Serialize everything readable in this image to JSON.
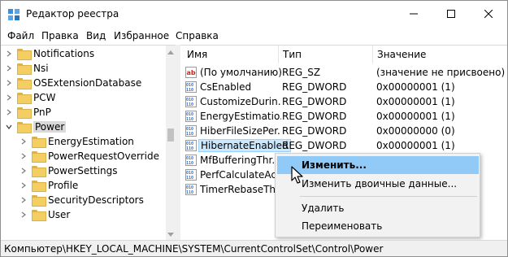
{
  "window": {
    "title": "Редактор реестра",
    "controls": [
      "minimize-icon",
      "maximize-icon",
      "close-icon"
    ]
  },
  "menu": [
    "Файл",
    "Правка",
    "Вид",
    "Избранное",
    "Справка"
  ],
  "tree": {
    "items": [
      {
        "label": "Notifications",
        "level": 1,
        "expander": "chevron-right-icon"
      },
      {
        "label": "Nsi",
        "level": 1,
        "expander": "chevron-right-icon"
      },
      {
        "label": "OSExtensionDatabase",
        "level": 1,
        "expander": "chevron-right-icon"
      },
      {
        "label": "PCW",
        "level": 1,
        "expander": "chevron-right-icon"
      },
      {
        "label": "PnP",
        "level": 1,
        "expander": "chevron-right-icon"
      },
      {
        "label": "Power",
        "level": 1,
        "expander": "chevron-down-icon",
        "selected": true
      },
      {
        "label": "EnergyEstimation",
        "level": 2,
        "expander": "chevron-right-icon"
      },
      {
        "label": "PowerRequestOverride",
        "level": 2,
        "expander": "chevron-right-icon"
      },
      {
        "label": "PowerSettings",
        "level": 2,
        "expander": "chevron-right-icon"
      },
      {
        "label": "Profile",
        "level": 2,
        "expander": "chevron-right-icon"
      },
      {
        "label": "SecurityDescriptors",
        "level": 2,
        "expander": "chevron-right-icon"
      },
      {
        "label": "User",
        "level": 2,
        "expander": "chevron-right-icon"
      }
    ]
  },
  "list": {
    "columns": [
      "Имя",
      "Тип",
      "Значение"
    ],
    "rows": [
      {
        "icon": "string-value-icon",
        "name": "(По умолчанию)",
        "type": "REG_SZ",
        "value": "(значение не присвоено)"
      },
      {
        "icon": "binary-value-icon",
        "name": "CsEnabled",
        "type": "REG_DWORD",
        "value": "0x00000001 (1)"
      },
      {
        "icon": "binary-value-icon",
        "name": "CustomizeDurin...",
        "type": "REG_DWORD",
        "value": "0x00000001 (1)"
      },
      {
        "icon": "binary-value-icon",
        "name": "EnergyEstimatio...",
        "type": "REG_DWORD",
        "value": "0x00000001 (1)"
      },
      {
        "icon": "binary-value-icon",
        "name": "HiberFileSizePer...",
        "type": "REG_DWORD",
        "value": "0x00000000 (0)"
      },
      {
        "icon": "binary-value-icon",
        "name": "HibernateEnabled",
        "type": "REG_DWORD",
        "value": "0x00000001 (1)",
        "selected": true
      },
      {
        "icon": "binary-value-icon",
        "name": "MfBufferingThr...",
        "type": "",
        "value": ""
      },
      {
        "icon": "binary-value-icon",
        "name": "PerfCalculateAc...",
        "type": "",
        "value": ""
      },
      {
        "icon": "binary-value-icon",
        "name": "TimerRebaseThr...",
        "type": "",
        "value": ""
      }
    ]
  },
  "context_menu": {
    "items": [
      "Изменить...",
      "Изменить двоичные данные...",
      "Удалить",
      "Переименовать"
    ],
    "highlighted": "Изменить..."
  },
  "status_bar": {
    "path": "Компьютер\\HKEY_LOCAL_MACHINE\\SYSTEM\\CurrentControlSet\\Control\\Power"
  },
  "colors": {
    "selection_bg": "#cce8ff",
    "menu_highlight": "#91c9f7",
    "folder": "#f3cf63",
    "reg_icon_blue": "#2b6fd1",
    "reg_icon_red": "#c8281e"
  }
}
